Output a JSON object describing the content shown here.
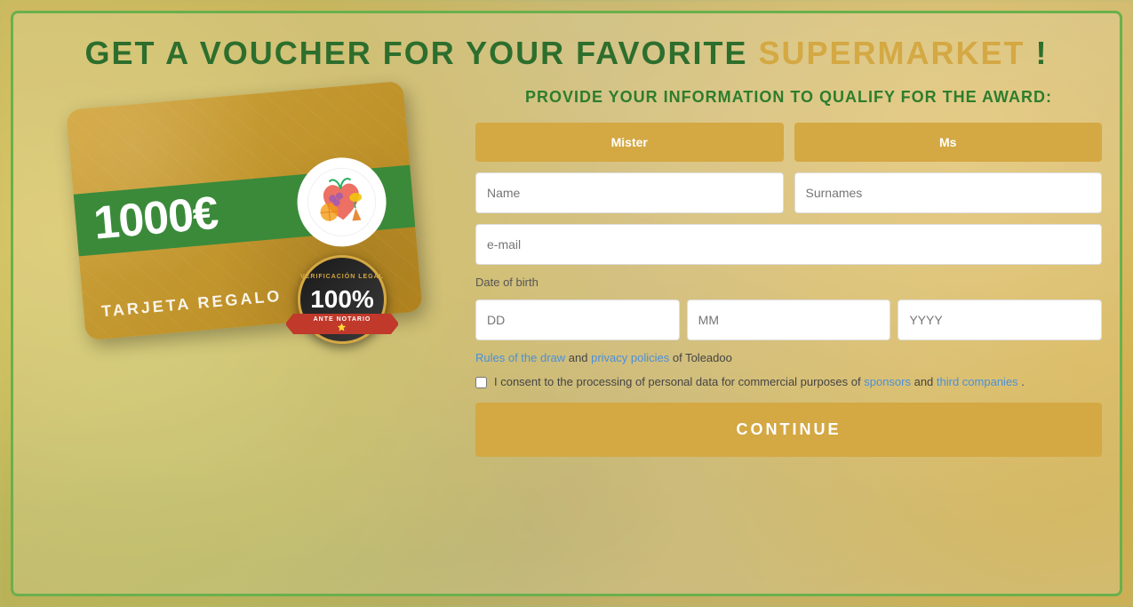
{
  "page": {
    "title": "Get a Voucher for Your Favorite Supermarket!",
    "title_part1": "GET A VOUCHER FOR YOUR FAVORITE ",
    "title_highlight": "SUPERMARKET",
    "title_end": " !",
    "form_subtitle": "PROVIDE YOUR INFORMATION TO QUALIFY FOR THE AWARD:"
  },
  "gift_card": {
    "amount": "1000€",
    "subtitle": "TARJETA REGALO",
    "seal_top_text": "VERIFICACIÓN LEGAL",
    "seal_percent": "100%",
    "seal_bottom": "ANTE NOTARIO"
  },
  "form": {
    "mister_label": "Mister",
    "ms_label": "Ms",
    "name_placeholder": "Name",
    "surnames_placeholder": "Surnames",
    "email_placeholder": "e-mail",
    "dob_label": "Date of birth",
    "dob_dd_placeholder": "DD",
    "dob_mm_placeholder": "MM",
    "dob_yyyy_placeholder": "YYYY",
    "rules_text1": "Rules of the draw",
    "rules_text2": " and ",
    "rules_text3": "privacy policies",
    "rules_text4": " of Toleadoo",
    "consent_text1": "I consent to the processing of personal data for commercial purposes of ",
    "consent_link1": "sponsors",
    "consent_text2": " and ",
    "consent_link2": "third companies",
    "consent_text3": " .",
    "continue_label": "CONTINUE"
  }
}
